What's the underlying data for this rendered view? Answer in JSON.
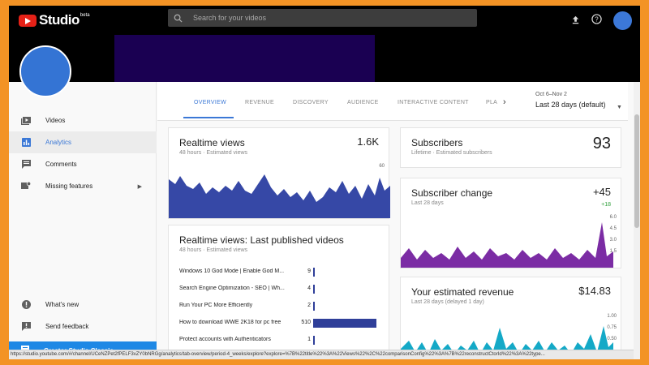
{
  "app": {
    "logo_text": "Studio",
    "logo_beta": "beta"
  },
  "header": {
    "search_placeholder": "Search for your videos"
  },
  "sidebar": {
    "items": [
      {
        "label": "Videos",
        "icon": "video-icon",
        "active": false
      },
      {
        "label": "Analytics",
        "icon": "analytics-icon",
        "active": true
      },
      {
        "label": "Comments",
        "icon": "comments-icon",
        "active": false
      },
      {
        "label": "Missing features",
        "icon": "missing-features-icon",
        "active": false
      }
    ],
    "bottom_items": [
      {
        "label": "What's new",
        "icon": "info-icon"
      },
      {
        "label": "Send feedback",
        "icon": "feedback-icon"
      }
    ],
    "classic_label": "Creator Studio Classic"
  },
  "tabs": {
    "items": [
      "OVERVIEW",
      "REVENUE",
      "DISCOVERY",
      "AUDIENCE",
      "INTERACTIVE CONTENT",
      "PLA"
    ],
    "active": "OVERVIEW"
  },
  "date_range": {
    "range": "Oct 6–Nov 2",
    "label": "Last 28 days (default)"
  },
  "realtime": {
    "title": "Realtime views",
    "subtitle": "48 hours · Estimated views",
    "value": "1.6K",
    "y_tick": "60",
    "color": "#3648a6"
  },
  "last_videos": {
    "title": "Realtime views: Last published videos",
    "subtitle": "48 hours · Estimated views",
    "color": "#2f3f99",
    "rows": [
      {
        "title": "Windows 10 God Mode | Enable God M...",
        "count": "9",
        "value": 9
      },
      {
        "title": "Search Engine Optimization - SEO | Wh...",
        "count": "4",
        "value": 4
      },
      {
        "title": "Run Your PC More Efficiently",
        "count": "2",
        "value": 2
      },
      {
        "title": "How to download WWE 2K18 for pc free",
        "count": "510",
        "value": 510
      },
      {
        "title": "Protect accounts with Authenticators",
        "count": "1",
        "value": 1
      }
    ]
  },
  "subscribers": {
    "title": "Subscribers",
    "subtitle": "Lifetime · Estimated subscribers",
    "value": "93"
  },
  "subscriber_change": {
    "title": "Subscriber change",
    "subtitle": "Last 28 days",
    "value": "+45",
    "delta": "+18",
    "y_ticks": [
      "6.0",
      "4.5",
      "3.0",
      "1.5"
    ],
    "color": "#7b2ca4"
  },
  "revenue": {
    "title": "Your estimated revenue",
    "subtitle": "Last 28 days (delayed 1 day)",
    "value": "$14.83",
    "y_ticks": [
      "1.00",
      "0.75",
      "0.50"
    ],
    "color": "#14a9c7"
  },
  "status_url": "https://studio.youtube.com/#/channel/UCeNZPet2fPELF3vZY0bNRGg/analytics/tab-overview/period-4_weeks/explore?explore=%7B%22title%22%3A%22Views%22%2C%22comparisonConfig%22%3A%7B%22reconstructCtorId%22%3A%22type..."
}
